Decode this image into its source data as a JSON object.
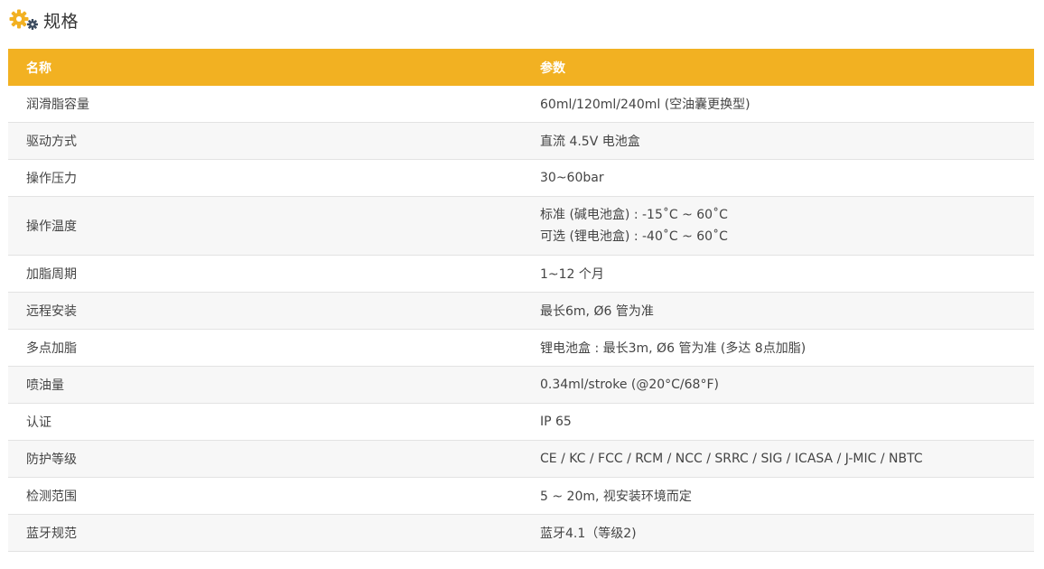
{
  "section": {
    "title": "规格",
    "icon": "gears-icon",
    "icon_colors": {
      "large": "#f2b122",
      "small": "#3a4a5e"
    }
  },
  "table": {
    "header_color": "#f2b122",
    "columns": [
      "名称",
      "参数"
    ],
    "rows": [
      {
        "name": "润滑脂容量",
        "value": "60ml/120ml/240ml (空油囊更换型)"
      },
      {
        "name": "驱动方式",
        "value": "直流 4.5V 电池盒"
      },
      {
        "name": "操作压力",
        "value": "30~60bar"
      },
      {
        "name": "操作温度",
        "value_lines": [
          "标准 (碱电池盒) : -15˚C ~ 60˚C",
          "可选 (锂电池盒) : -40˚C ~ 60˚C"
        ]
      },
      {
        "name": "加脂周期",
        "value": "1~12 个月"
      },
      {
        "name": "远程安装",
        "value": "最长6m, Ø6 管为准"
      },
      {
        "name": "多点加脂",
        "value": "锂电池盒 : 最长3m, Ø6 管为准 (多达 8点加脂)"
      },
      {
        "name": "喷油量",
        "value": "0.34ml/stroke (@20°C/68°F)"
      },
      {
        "name": "认证",
        "value": "IP 65"
      },
      {
        "name": "防护等级",
        "value": "CE / KC / FCC / RCM / NCC / SRRC / SIG / ICASA / J-MIC / NBTC"
      },
      {
        "name": "检测范围",
        "value": "5 ~ 20m, 视安装环境而定"
      },
      {
        "name": "蓝牙规范",
        "value": "蓝牙4.1（等级2)"
      }
    ]
  }
}
